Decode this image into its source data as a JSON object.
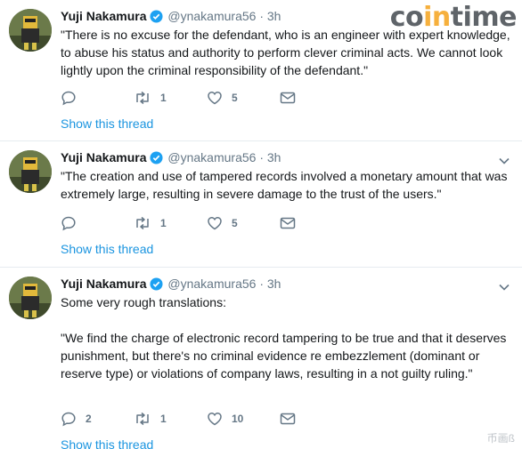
{
  "watermark": {
    "brand_left": "co",
    "brand_mid": "in",
    "brand_right": "time",
    "corner_text": "币画ß"
  },
  "colors": {
    "link": "#1b95e0",
    "muted": "#657786",
    "verified": "#1da1f2",
    "divider": "#e6ecf0"
  },
  "tweets": [
    {
      "name": "Yuji Nakamura",
      "handle": "@ynakamura56",
      "sep": "·",
      "time": "3h",
      "text": "\"There is no excuse for the defendant, who is an engineer with expert knowledge, to abuse his status and authority to perform clever criminal acts. We cannot look lightly upon the criminal responsibility of the defendant.\"",
      "reply_count": "",
      "retweet_count": "1",
      "like_count": "5",
      "show_thread": "Show this thread"
    },
    {
      "name": "Yuji Nakamura",
      "handle": "@ynakamura56",
      "sep": "·",
      "time": "3h",
      "text": "\"The creation and use of tampered records involved a monetary amount that was extremely large, resulting in severe damage to the trust of the users.\"",
      "reply_count": "",
      "retweet_count": "1",
      "like_count": "5",
      "show_thread": "Show this thread"
    },
    {
      "name": "Yuji Nakamura",
      "handle": "@ynakamura56",
      "sep": "·",
      "time": "3h",
      "text": "Some very rough translations:\n\n\"We find the charge of electronic record tampering to be true and that it deserves punishment, but there's no criminal evidence re embezzlement (dominant or reserve type) or violations of company laws, resulting in a not guilty ruling.\"",
      "reply_count": "2",
      "retweet_count": "1",
      "like_count": "10",
      "show_thread": "Show this thread"
    }
  ]
}
